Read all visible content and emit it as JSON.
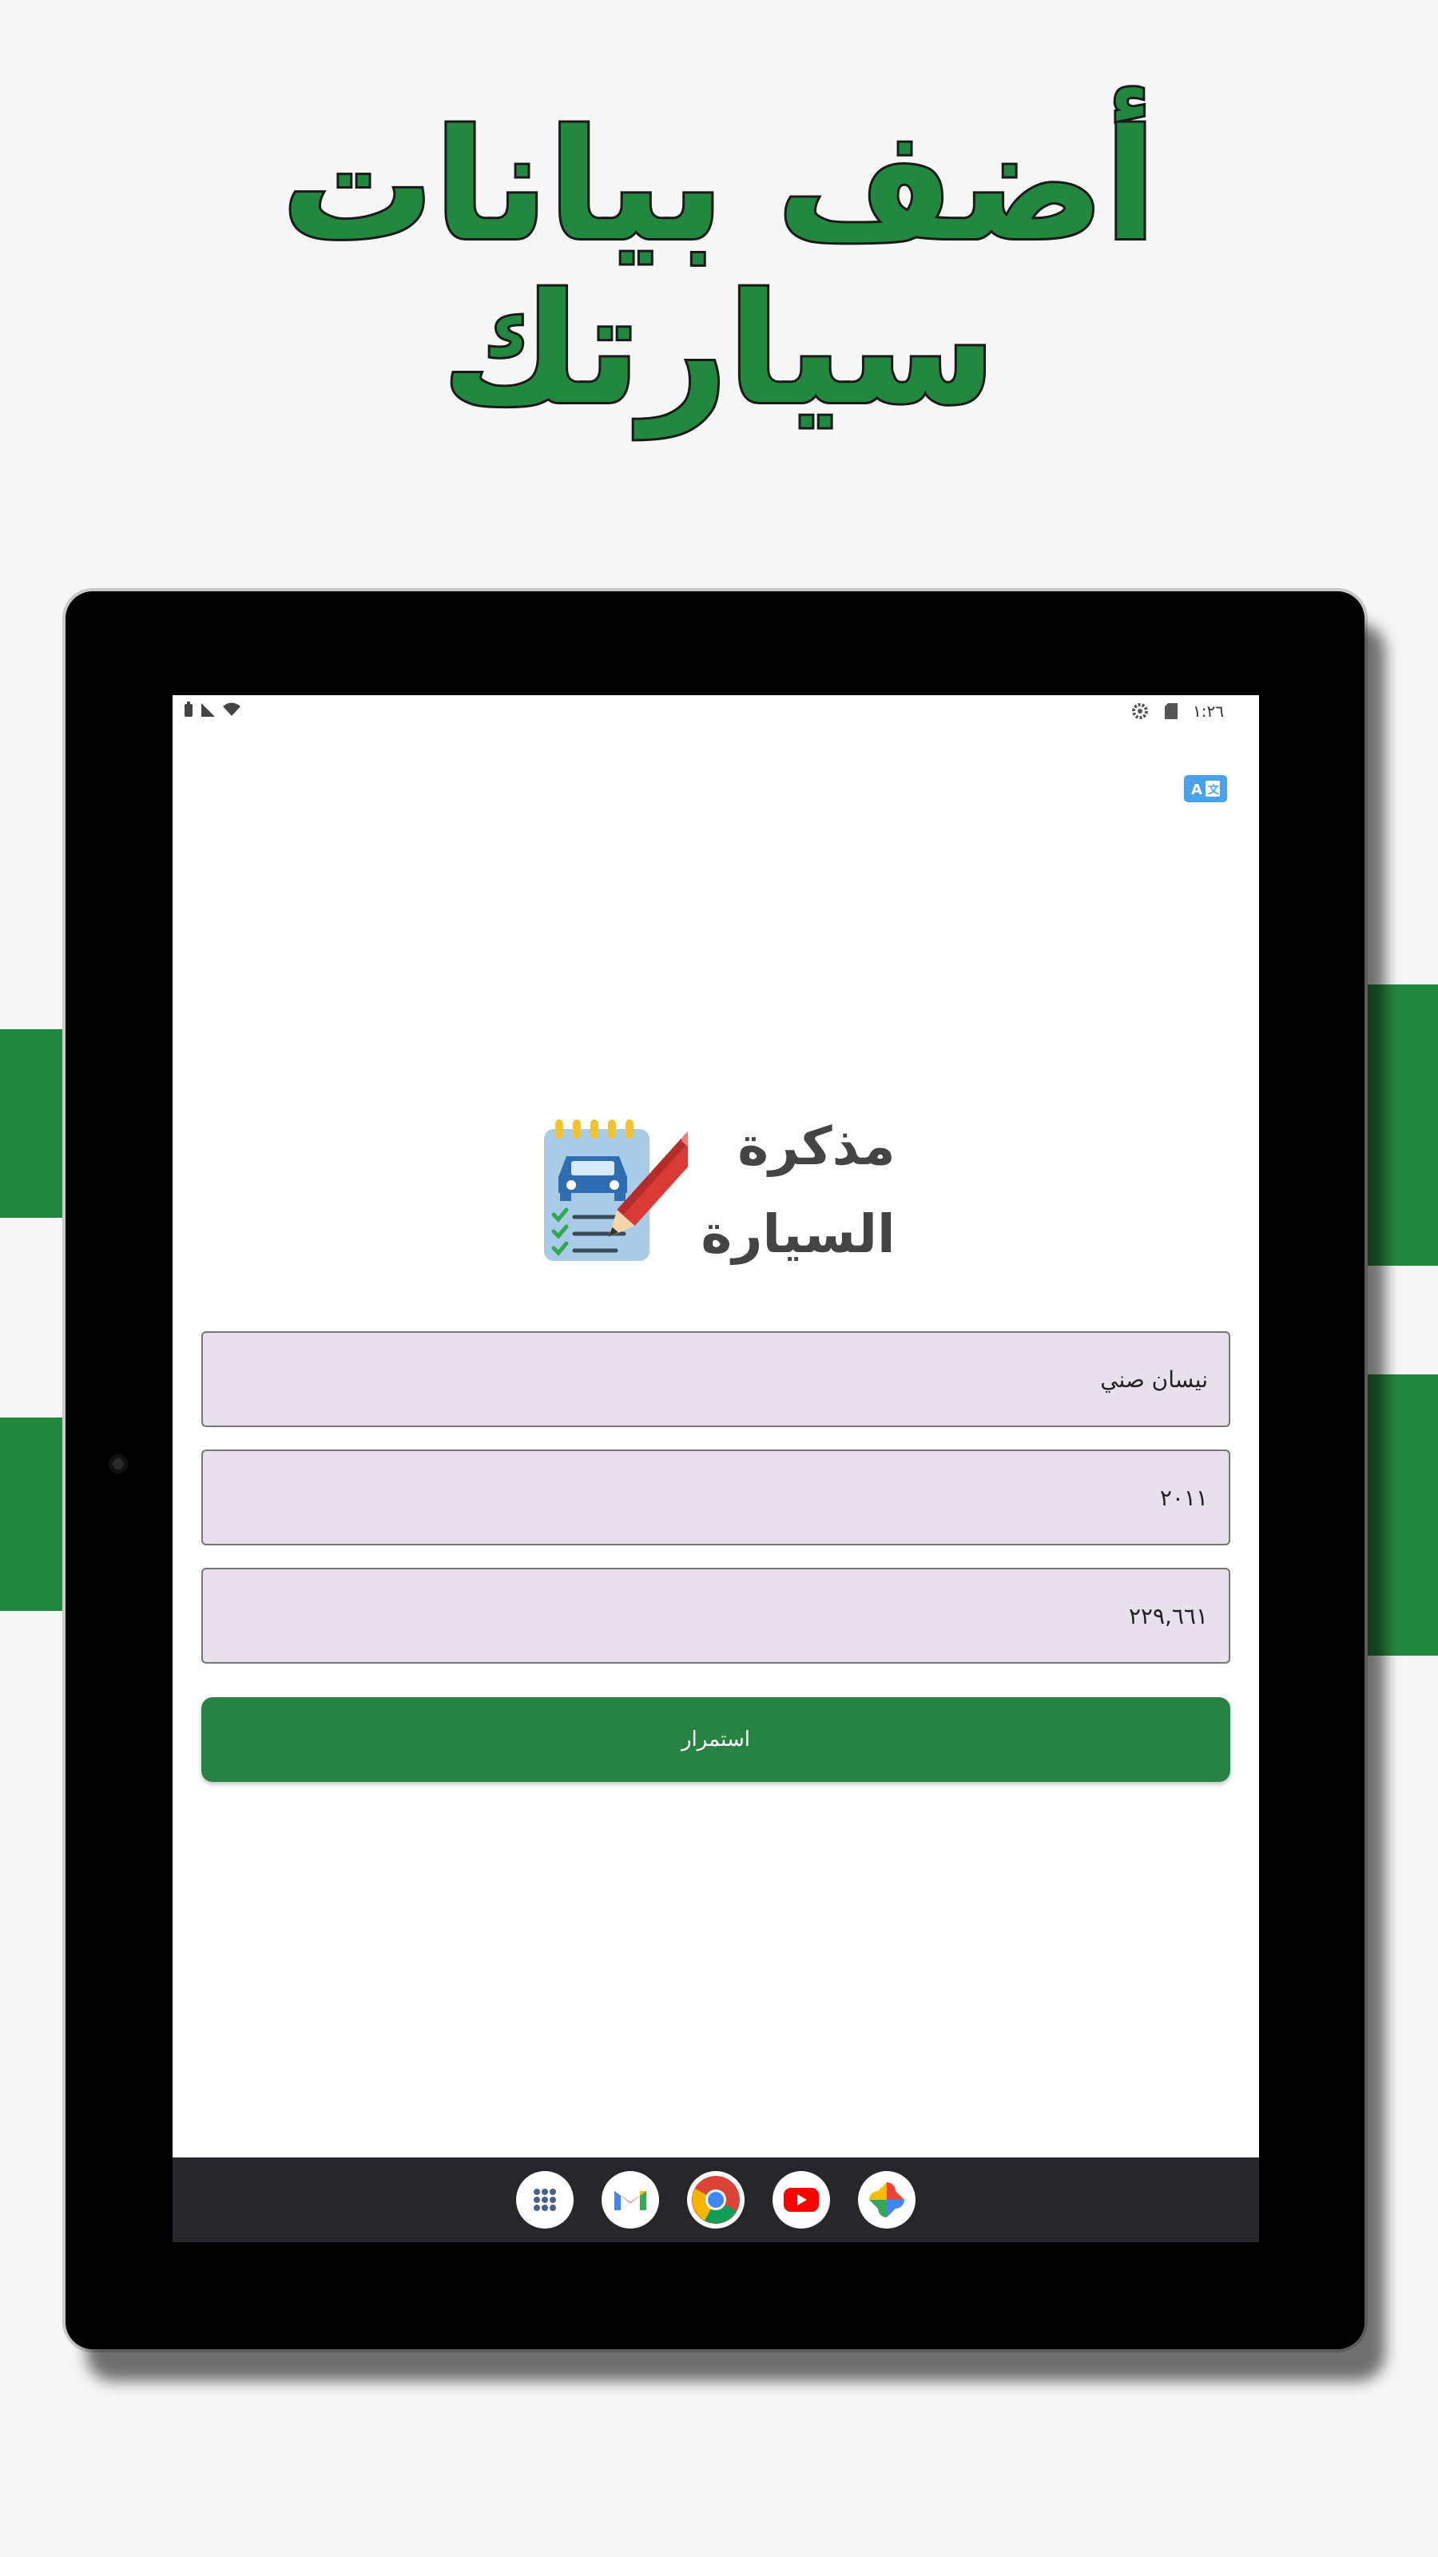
{
  "promo": {
    "headline_line1": "أضف بيانات",
    "headline_line2": "سيارتك"
  },
  "colors": {
    "brand_green": "#23883f",
    "button_green": "#268344",
    "field_bg": "#e8e0ed"
  },
  "status_bar": {
    "time": "١:٢٦"
  },
  "app": {
    "title_line1": "مذكرة",
    "title_line2": "السيارة"
  },
  "form": {
    "car_model_value": "نيسان صني",
    "year_value": "٢٠١١",
    "mileage_value": "٢٢٩,٦٦١",
    "continue_label": "استمرار"
  },
  "taskbar": {
    "apps": [
      "app-launcher-icon",
      "gmail-icon",
      "chrome-icon",
      "youtube-icon",
      "photos-icon"
    ]
  }
}
